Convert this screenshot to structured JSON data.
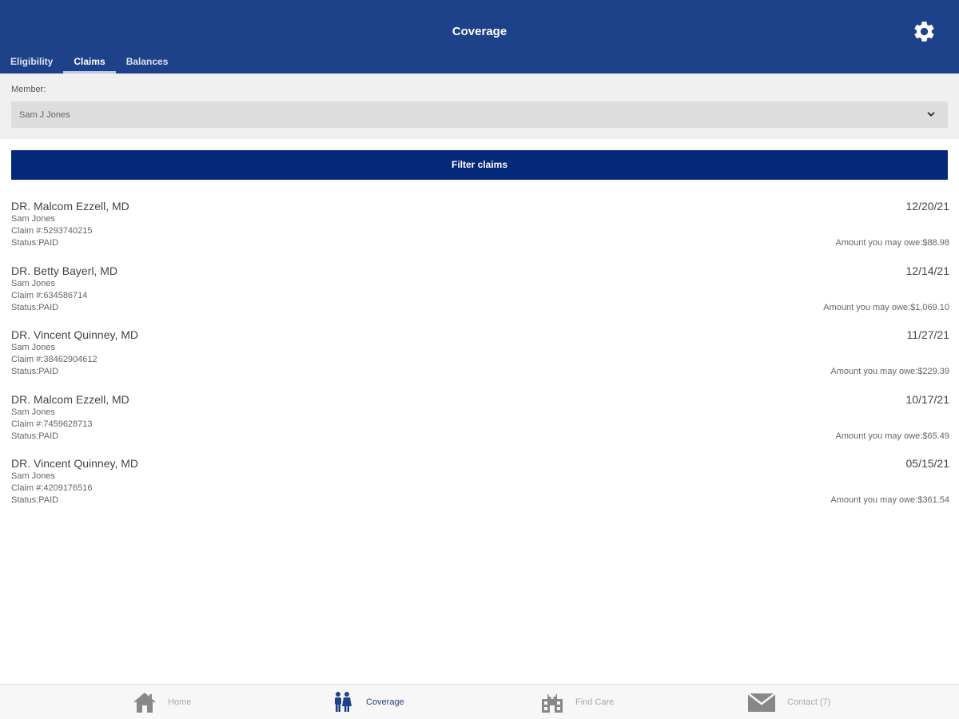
{
  "header": {
    "title": "Coverage",
    "settings_icon": "gear-icon"
  },
  "tabs": [
    {
      "label": "Eligibility",
      "active": false
    },
    {
      "label": "Claims",
      "active": true
    },
    {
      "label": "Balances",
      "active": false
    }
  ],
  "member_filter": {
    "label": "Member:",
    "selected": "Sam J Jones"
  },
  "filter_button": {
    "label": "Filter claims"
  },
  "claims": [
    {
      "provider": "DR. Malcom Ezzell, MD",
      "member": "Sam Jones",
      "claim_number": "Claim #:5293740215",
      "status": "Status:PAID",
      "date": "12/20/21",
      "amount": "Amount you may owe:$88.98"
    },
    {
      "provider": "DR. Betty Bayerl, MD",
      "member": "Sam Jones",
      "claim_number": "Claim #:634586714",
      "status": "Status:PAID",
      "date": "12/14/21",
      "amount": "Amount you may owe:$1,069.10"
    },
    {
      "provider": "DR. Vincent Quinney, MD",
      "member": "Sam Jones",
      "claim_number": "Claim #:38462904612",
      "status": "Status:PAID",
      "date": "11/27/21",
      "amount": "Amount you may owe:$229.39"
    },
    {
      "provider": "DR. Malcom Ezzell, MD",
      "member": "Sam Jones",
      "claim_number": "Claim #:7459628713",
      "status": "Status:PAID",
      "date": "10/17/21",
      "amount": "Amount you may owe:$65.49"
    },
    {
      "provider": "DR. Vincent Quinney, MD",
      "member": "Sam Jones",
      "claim_number": "Claim #:4209176516",
      "status": "Status:PAID",
      "date": "05/15/21",
      "amount": "Amount you may owe:$361.54"
    }
  ],
  "bottom_nav": [
    {
      "label": "Home",
      "icon": "home-icon",
      "active": false
    },
    {
      "label": "Coverage",
      "icon": "people-icon",
      "active": true
    },
    {
      "label": "Find Care",
      "icon": "hospital-icon",
      "active": false
    },
    {
      "label": "Contact (7)",
      "icon": "mail-icon",
      "active": false
    }
  ],
  "colors": {
    "header_bg": "#1e4289",
    "button_bg": "#05297a",
    "active_nav": "#1e4289",
    "inactive_nav": "#aaaaaa"
  }
}
